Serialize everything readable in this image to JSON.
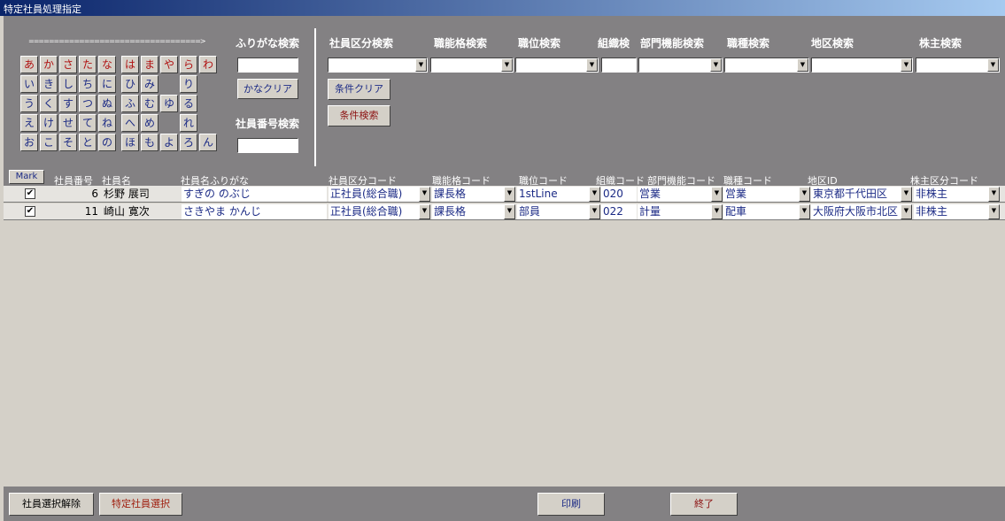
{
  "window": {
    "title": "特定社員処理指定"
  },
  "kana": {
    "header": "ふりがな検索",
    "arrow": "==================================>",
    "rows": [
      [
        "あ",
        "か",
        "さ",
        "た",
        "な",
        "は",
        "ま",
        "や",
        "ら",
        "わ"
      ],
      [
        "い",
        "き",
        "し",
        "ち",
        "に",
        "ひ",
        "み",
        "",
        "り",
        ""
      ],
      [
        "う",
        "く",
        "す",
        "つ",
        "ぬ",
        "ふ",
        "む",
        "ゆ",
        "る",
        ""
      ],
      [
        "え",
        "け",
        "せ",
        "て",
        "ね",
        "へ",
        "め",
        "",
        "れ",
        ""
      ],
      [
        "お",
        "こ",
        "そ",
        "と",
        "の",
        "ほ",
        "も",
        "よ",
        "ろ",
        "ん"
      ]
    ],
    "clear_label": "かなクリア",
    "empno_header": "社員番号検索"
  },
  "search": {
    "headers": [
      "社員区分検索",
      "職能格検索",
      "職位検索",
      "組織検",
      "部門機能検索",
      "職種検索",
      "地区検索",
      "株主検索"
    ],
    "cond_clear": "条件クリア",
    "cond_search": "条件検索"
  },
  "table": {
    "mark_label": "Mark",
    "columns": [
      "社員番号",
      "社員名",
      "社員名ふりがな",
      "社員区分コード",
      "職能格コード",
      "職位コード",
      "組織コード",
      "部門機能コード",
      "職種コード",
      "地区ID",
      "株主区分コード"
    ],
    "rows": [
      {
        "checked": "✔",
        "num": "6",
        "name": "杉野 展司",
        "furigana": "すぎの のぶじ",
        "kubun": "正社員(総合職)",
        "shokuno": "課長格",
        "shokui": "1stLine",
        "soshiki": "020",
        "bumon": "営業",
        "shokushu": "営業",
        "chiku": "東京都千代田区",
        "kabunushi": "非株主"
      },
      {
        "checked": "✔",
        "num": "11",
        "name": "崎山 寛次",
        "furigana": "さきやま かんじ",
        "kubun": "正社員(総合職)",
        "shokuno": "課長格",
        "shokui": "部員",
        "soshiki": "022",
        "bumon": "計量",
        "shokushu": "配車",
        "chiku": "大阪府大阪市北区",
        "kabunushi": "非株主"
      }
    ]
  },
  "footer": {
    "deselect": "社員選択解除",
    "select": "特定社員選択",
    "print": "印刷",
    "exit": "終了"
  }
}
